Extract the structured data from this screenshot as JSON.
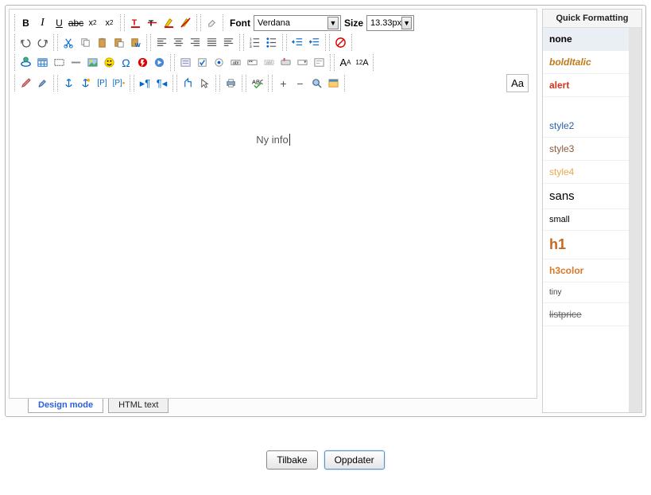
{
  "font": {
    "label": "Font",
    "value": "Verdana"
  },
  "size": {
    "label": "Size",
    "value": "13.33px"
  },
  "aa": "Aa",
  "content": "Ny info",
  "tabs": {
    "design": "Design mode",
    "html": "HTML text"
  },
  "qf": {
    "header": "Quick Formatting",
    "items": {
      "none": "none",
      "boldItalic": "boldItalic",
      "alert": "alert",
      "style2": "style2",
      "style3": "style3",
      "style4": "style4",
      "sans": "sans",
      "small": "small",
      "h1": "h1",
      "h3color": "h3color",
      "tiny": "tiny",
      "listprice": "listprice"
    }
  },
  "buttons": {
    "back": "Tilbake",
    "update": "Oppdater"
  }
}
